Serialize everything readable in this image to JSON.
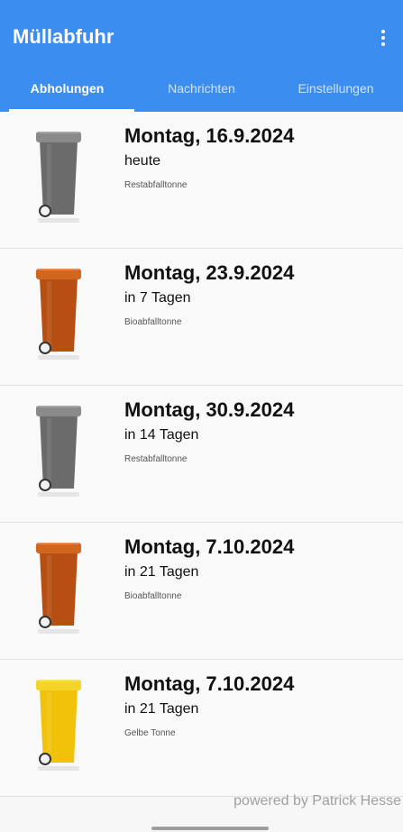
{
  "app": {
    "title": "Müllabfuhr"
  },
  "tabs": [
    {
      "label": "Abholungen",
      "active": true
    },
    {
      "label": "Nachrichten",
      "active": false
    },
    {
      "label": "Einstellungen",
      "active": false
    }
  ],
  "pickups": [
    {
      "date": "Montag, 16.9.2024",
      "relative": "heute",
      "type": "Restabfalltonne",
      "bin_color": "#6b6b6b",
      "lid_color": "#8a8a8a"
    },
    {
      "date": "Montag, 23.9.2024",
      "relative": "in 7 Tagen",
      "type": "Bioabfalltonne",
      "bin_color": "#b84f12",
      "lid_color": "#d3661f"
    },
    {
      "date": "Montag, 30.9.2024",
      "relative": "in 14 Tagen",
      "type": "Restabfalltonne",
      "bin_color": "#6b6b6b",
      "lid_color": "#8a8a8a"
    },
    {
      "date": "Montag, 7.10.2024",
      "relative": "in 21 Tagen",
      "type": "Bioabfalltonne",
      "bin_color": "#b84f12",
      "lid_color": "#d3661f"
    },
    {
      "date": "Montag, 7.10.2024",
      "relative": "in 21 Tagen",
      "type": "Gelbe Tonne",
      "bin_color": "#f0c30a",
      "lid_color": "#f5d42a"
    }
  ],
  "footer": {
    "powered_by": "powered by Patrick Hesse"
  },
  "colors": {
    "appbar": "#3b8ef0"
  }
}
